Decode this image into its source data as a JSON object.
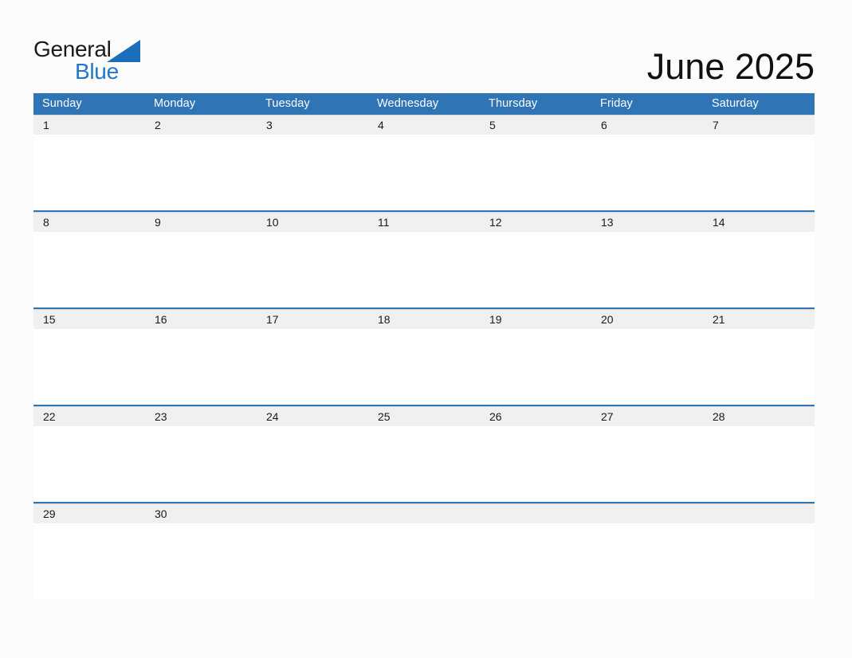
{
  "brand": {
    "name_part1": "General",
    "name_part2": "Blue",
    "triangle_color": "#1b6fba",
    "text_color_primary": "#1a1a1a",
    "text_color_secondary": "#2277c8"
  },
  "header": {
    "title": "June 2025",
    "month": "June",
    "year": "2025"
  },
  "colors": {
    "header_blue": "#2f75b5",
    "rule_blue": "#2f75b5",
    "date_band_gray": "#f0f0f0",
    "page_background": "#fcfcfd",
    "cell_white": "#ffffff",
    "header_text": "#ffffff"
  },
  "calendar": {
    "weekdays": [
      "Sunday",
      "Monday",
      "Tuesday",
      "Wednesday",
      "Thursday",
      "Friday",
      "Saturday"
    ],
    "weeks": [
      {
        "days": [
          {
            "date": "1",
            "events": ""
          },
          {
            "date": "2",
            "events": ""
          },
          {
            "date": "3",
            "events": ""
          },
          {
            "date": "4",
            "events": ""
          },
          {
            "date": "5",
            "events": ""
          },
          {
            "date": "6",
            "events": ""
          },
          {
            "date": "7",
            "events": ""
          }
        ]
      },
      {
        "days": [
          {
            "date": "8",
            "events": ""
          },
          {
            "date": "9",
            "events": ""
          },
          {
            "date": "10",
            "events": ""
          },
          {
            "date": "11",
            "events": ""
          },
          {
            "date": "12",
            "events": ""
          },
          {
            "date": "13",
            "events": ""
          },
          {
            "date": "14",
            "events": ""
          }
        ]
      },
      {
        "days": [
          {
            "date": "15",
            "events": ""
          },
          {
            "date": "16",
            "events": ""
          },
          {
            "date": "17",
            "events": ""
          },
          {
            "date": "18",
            "events": ""
          },
          {
            "date": "19",
            "events": ""
          },
          {
            "date": "20",
            "events": ""
          },
          {
            "date": "21",
            "events": ""
          }
        ]
      },
      {
        "days": [
          {
            "date": "22",
            "events": ""
          },
          {
            "date": "23",
            "events": ""
          },
          {
            "date": "24",
            "events": ""
          },
          {
            "date": "25",
            "events": ""
          },
          {
            "date": "26",
            "events": ""
          },
          {
            "date": "27",
            "events": ""
          },
          {
            "date": "28",
            "events": ""
          }
        ]
      },
      {
        "days": [
          {
            "date": "29",
            "events": ""
          },
          {
            "date": "30",
            "events": ""
          },
          {
            "date": "",
            "events": ""
          },
          {
            "date": "",
            "events": ""
          },
          {
            "date": "",
            "events": ""
          },
          {
            "date": "",
            "events": ""
          },
          {
            "date": "",
            "events": ""
          }
        ]
      }
    ]
  }
}
